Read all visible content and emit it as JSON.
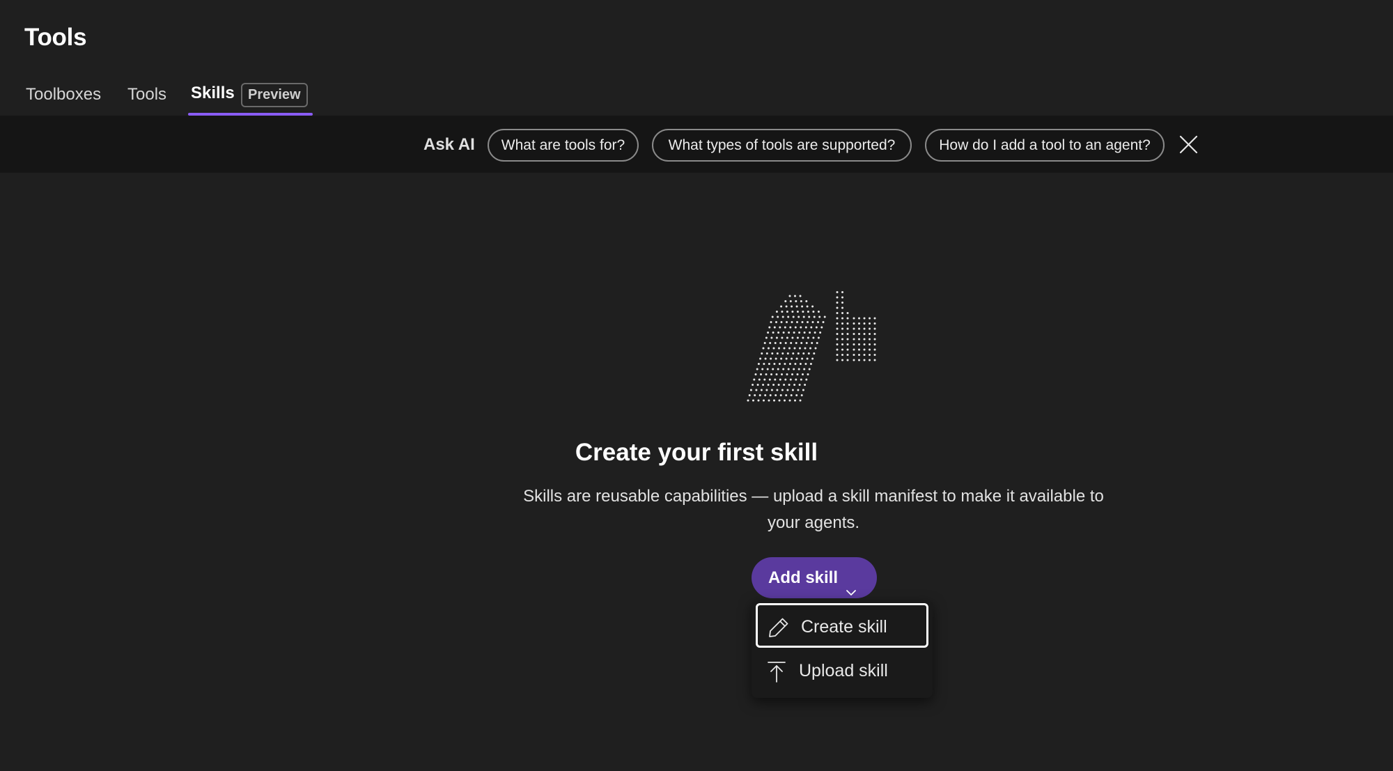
{
  "header": {
    "title": "Tools",
    "tabs": [
      {
        "label": "Toolboxes",
        "active": false
      },
      {
        "label": "Tools",
        "active": false
      },
      {
        "label": "Skills",
        "active": true,
        "badge": "Preview"
      }
    ]
  },
  "ask_ai": {
    "label": "Ask AI",
    "suggestions": [
      "What are tools for?",
      "What types of tools are supported?",
      "How do I add a tool to an agent?"
    ],
    "close_icon": "close-icon"
  },
  "empty_state": {
    "illustration_icon": "dotted-hands-icon",
    "title": "Create your first skill",
    "description": "Skills are reusable capabilities — upload a skill manifest to make it available to your agents."
  },
  "add_skill": {
    "label": "Add skill",
    "icon": "chevron-down-icon",
    "menu": [
      {
        "label": "Create skill",
        "icon": "pencil-icon",
        "focused": true
      },
      {
        "label": "Upload skill",
        "icon": "upload-icon",
        "focused": false
      }
    ]
  },
  "colors": {
    "background": "#1f1f1f",
    "ask_ai_bar": "#151515",
    "accent_underline": "#8a5cf5",
    "primary_button": "#5a3a9e"
  }
}
